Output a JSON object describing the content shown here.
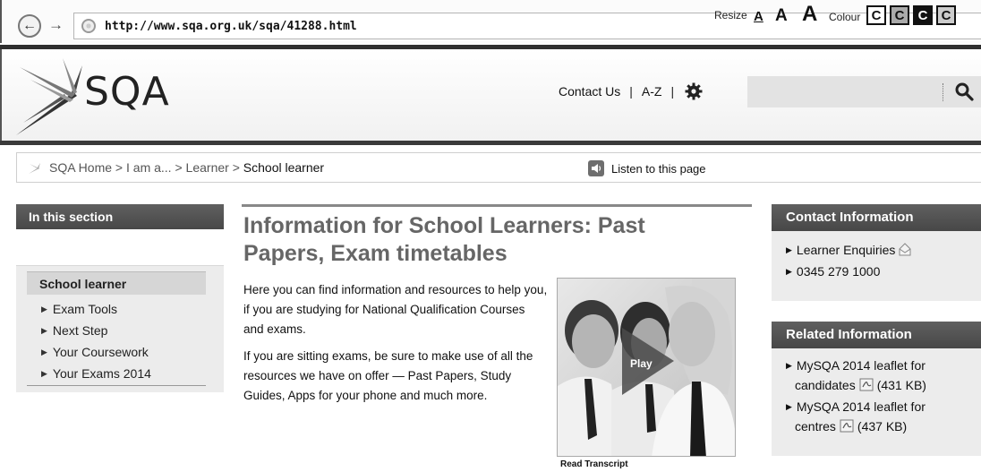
{
  "browser": {
    "url": "http://www.sqa.org.uk/sqa/41288.html"
  },
  "header": {
    "logo_text": "SQA",
    "links": [
      "Contact Us",
      "A-Z"
    ],
    "separator": "|",
    "search": {
      "placeholder": ""
    }
  },
  "breadcrumb": {
    "items": [
      "SQA Home",
      "I am a...",
      "Learner"
    ],
    "current": "School learner",
    "separator": " > "
  },
  "accessibility": {
    "listen_label": "Listen to this page",
    "resize_label": "Resize",
    "resize_options": [
      "A",
      "A",
      "A"
    ],
    "colour_label": "Colour",
    "colour_options": [
      "C",
      "C",
      "C",
      "C"
    ]
  },
  "left_sidebar": {
    "heading": "In this section",
    "active_item": "School learner",
    "items": [
      "Exam Tools",
      "Next Step",
      "Your Coursework",
      "Your Exams 2014"
    ]
  },
  "main": {
    "title": "Information for School Learners: Past Papers, Exam timetables",
    "paragraph1": "Here you can find information and resources to help you, if you are studying for National Qualification Courses and exams.",
    "paragraph2": "If you are sitting exams, be sure to make use of all the resources we have on offer — Past Papers, Study Guides, Apps for your phone and much more.",
    "video": {
      "play_label": "Play",
      "transcript_label": "Read Transcript"
    }
  },
  "right_sidebar": {
    "contact": {
      "heading": "Contact Information",
      "items": [
        "Learner Enquiries",
        "0345 279 1000"
      ]
    },
    "related": {
      "heading": "Related Information",
      "items": [
        {
          "text_line1": "MySQA 2014 leaflet for",
          "text_line2": "candidates",
          "size": "(431 KB)"
        },
        {
          "text_line1": "MySQA 2014 leaflet for",
          "text_line2": "centres",
          "size": "(437 KB)"
        }
      ]
    }
  }
}
